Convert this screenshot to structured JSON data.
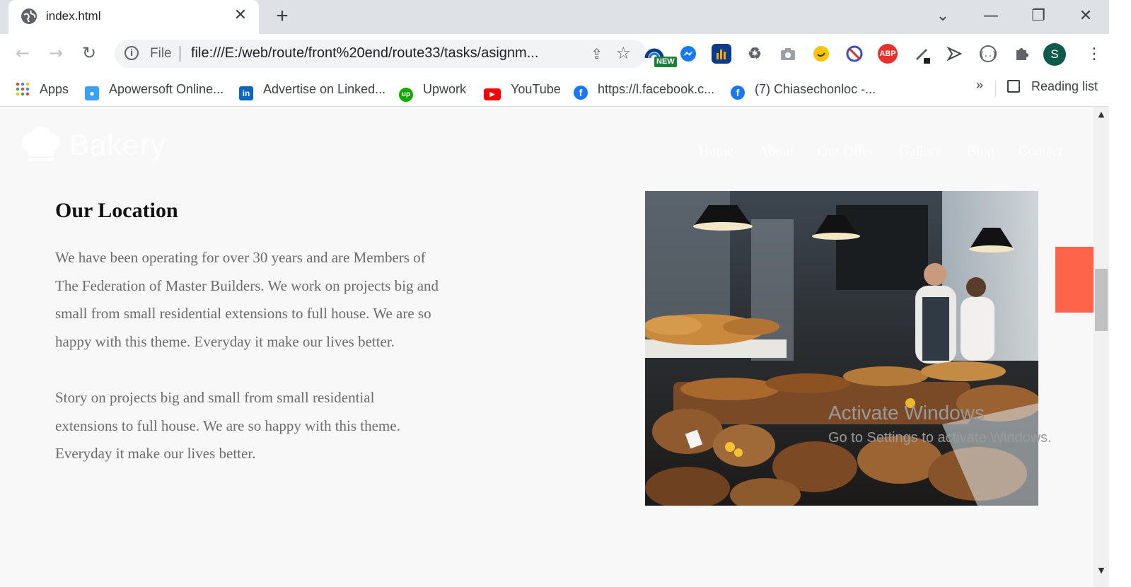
{
  "browser": {
    "tab": {
      "title": "index.html",
      "close": "✕"
    },
    "new_tab": "+",
    "window_controls": {
      "tab_search": "⌄",
      "minimize": "—",
      "restore": "❐",
      "close": "✕"
    },
    "nav": {
      "back": "←",
      "forward": "→",
      "reload": "↻"
    },
    "omnibox": {
      "info": "i",
      "scheme_label": "File",
      "url": "file:///E:/web/route/front%20end/route33/tasks/asignm...",
      "share_icon": "⇪",
      "star_icon": "☆"
    },
    "extensions": [
      {
        "name": "new-extension-icon",
        "badge": "NEW"
      },
      {
        "name": "messenger-icon"
      },
      {
        "name": "analytics-icon"
      },
      {
        "name": "recycle-icon"
      },
      {
        "name": "camera-icon"
      },
      {
        "name": "emoji-icon"
      },
      {
        "name": "block-icon"
      },
      {
        "name": "abp-icon",
        "label": "ABP"
      },
      {
        "name": "eyedropper-icon"
      },
      {
        "name": "send-icon"
      },
      {
        "name": "code-icon"
      },
      {
        "name": "puzzle-icon"
      }
    ],
    "profile_initial": "S",
    "menu": "⋮"
  },
  "bookmarks": {
    "items": [
      {
        "label": "Apps"
      },
      {
        "label": "Apowersoft Online..."
      },
      {
        "label": "Advertise on Linked..."
      },
      {
        "label": "Upwork"
      },
      {
        "label": "YouTube"
      },
      {
        "label": "https://l.facebook.c..."
      },
      {
        "label": "(7) Chiasechonloc -..."
      }
    ],
    "more": "»",
    "reading_list": "Reading list"
  },
  "page": {
    "logo_text": "Bakery",
    "nav": [
      "Home",
      "About",
      "Our Offer",
      "Gallery",
      "Blog",
      "Contact"
    ],
    "heading": "Our Location",
    "paragraphs": [
      "We have been operating for over 30 years and are Members of The Federation of Master Builders. We work on projects big and small from small residential extensions to full house. We are so happy with this theme. Everyday it make our lives better.",
      "Story on projects big and small from small residential extensions to full house. We are so happy with this theme. Everyday it make our lives better."
    ],
    "accent_color": "#fe6449"
  },
  "os_watermark": {
    "line1": "Activate Windows",
    "line2": "Go to Settings to activate Windows."
  },
  "scrollbar": {
    "up": "▲",
    "down": "▼"
  }
}
